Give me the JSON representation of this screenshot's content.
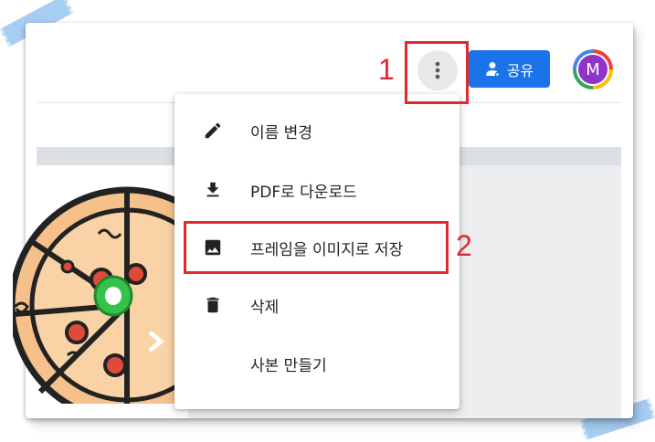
{
  "toolbar": {
    "more_icon": "more-vert-icon",
    "share_label": "공유",
    "share_icon": "person-share-icon",
    "avatar_initial": "M"
  },
  "menu": {
    "items": [
      {
        "label": "이름 변경",
        "icon": "pencil-icon"
      },
      {
        "label": "PDF로 다운로드",
        "icon": "download-icon"
      },
      {
        "label": "프레임을 이미지로 저장",
        "icon": "image-icon"
      },
      {
        "label": "삭제",
        "icon": "trash-icon"
      },
      {
        "label": "사본 만들기",
        "icon": ""
      }
    ]
  },
  "annotations": {
    "step1": "1",
    "step2": "2"
  },
  "colors": {
    "accent": "#1a73e8",
    "highlight": "#e0282e",
    "avatar": "#8e35c8"
  }
}
